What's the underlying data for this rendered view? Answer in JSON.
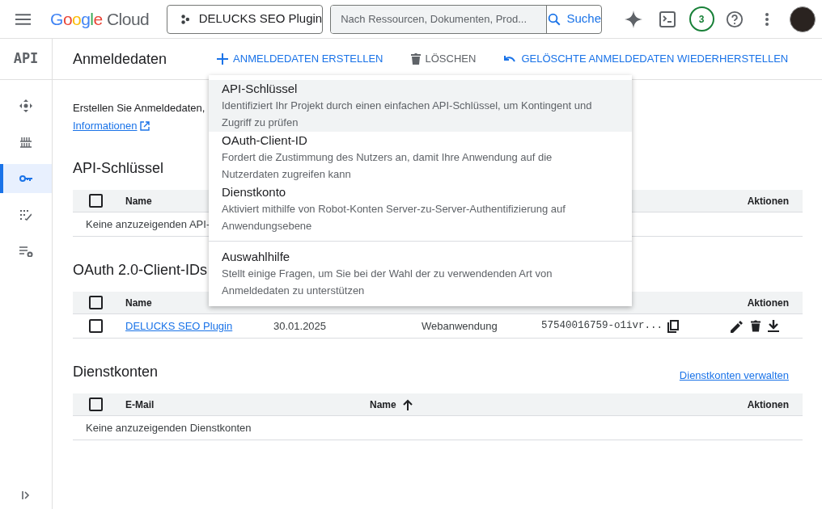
{
  "topbar": {
    "logo": {
      "word": "Google",
      "product": "Cloud"
    },
    "project": "DELUCKS SEO Plugin",
    "search": {
      "placeholder": "Nach Ressourcen, Dokumenten, Prod...",
      "button": "Suche"
    },
    "notifications": "3"
  },
  "sidebar": {
    "title": "API",
    "items": [
      {
        "kind": "move",
        "selected": false
      },
      {
        "kind": "library",
        "selected": false
      },
      {
        "kind": "key",
        "selected": true
      },
      {
        "kind": "checklist",
        "selected": false
      },
      {
        "kind": "settings",
        "selected": false
      }
    ]
  },
  "toolbar": {
    "title": "Anmeldedaten",
    "actions": [
      {
        "label": "ANMELDEDATEN ERSTELLEN",
        "kind": "create",
        "disabled": false
      },
      {
        "label": "LÖSCHEN",
        "kind": "delete",
        "disabled": true
      },
      {
        "label": "GELÖSCHTE ANMELDEDATEN WIEDERHERSTELLEN",
        "kind": "restore",
        "disabled": false
      }
    ]
  },
  "intro": {
    "text": "Erstellen Sie Anmeldedaten,",
    "link": "Informationen"
  },
  "sections": [
    {
      "title": "API-Schlüssel",
      "columns": [
        {
          "label": "Name",
          "kind": "plain"
        },
        {
          "label": "Aktionen",
          "kind": "plain"
        }
      ],
      "checkbox_checked": false,
      "empty": "Keine anzuzeigenden API-"
    },
    {
      "title": "OAuth 2.0-Client-IDs",
      "columns": [
        {
          "label": "Name",
          "kind": "plain"
        },
        {
          "label": "Aktionen",
          "kind": "plain"
        }
      ],
      "checkbox_checked": false,
      "rows": [
        {
          "checked": false,
          "name": "DELUCKS SEO Plugin",
          "date": "30.01.2025",
          "type": "Webanwendung",
          "client_id": "57540016759-o1ivr..."
        }
      ]
    },
    {
      "title": "Dienstkonten",
      "link": "Dienstkonten verwalten",
      "columns": [
        {
          "label": "E-Mail",
          "kind": "plain"
        },
        {
          "label": "Name",
          "kind": "sort-up"
        },
        {
          "label": "Aktionen",
          "kind": "plain"
        }
      ],
      "checkbox_checked": false,
      "empty": "Keine anzuzeigenden Dienstkonten"
    }
  ],
  "menu": {
    "items": [
      {
        "title": "API-Schlüssel",
        "description": "Identifiziert Ihr Projekt durch einen einfachen API-Schlüssel, um Kontingent und Zugriff zu prüfen",
        "selected": true,
        "divider_before": false
      },
      {
        "title": "OAuth-Client-ID",
        "description": "Fordert die Zustimmung des Nutzers an, damit Ihre Anwendung auf die Nutzerdaten zugreifen kann",
        "selected": false,
        "divider_before": false
      },
      {
        "title": "Dienstkonto",
        "description": "Aktiviert mithilfe von Robot-Konten Server-zu-Server-Authentifizierung auf Anwendungsebene",
        "selected": false,
        "divider_before": false
      },
      {
        "title": "Auswahlhilfe",
        "description": "Stellt einige Fragen, um Sie bei der Wahl der zu verwendenden Art von Anmeldedaten zu unterstützen",
        "selected": false,
        "divider_before": true
      }
    ]
  }
}
